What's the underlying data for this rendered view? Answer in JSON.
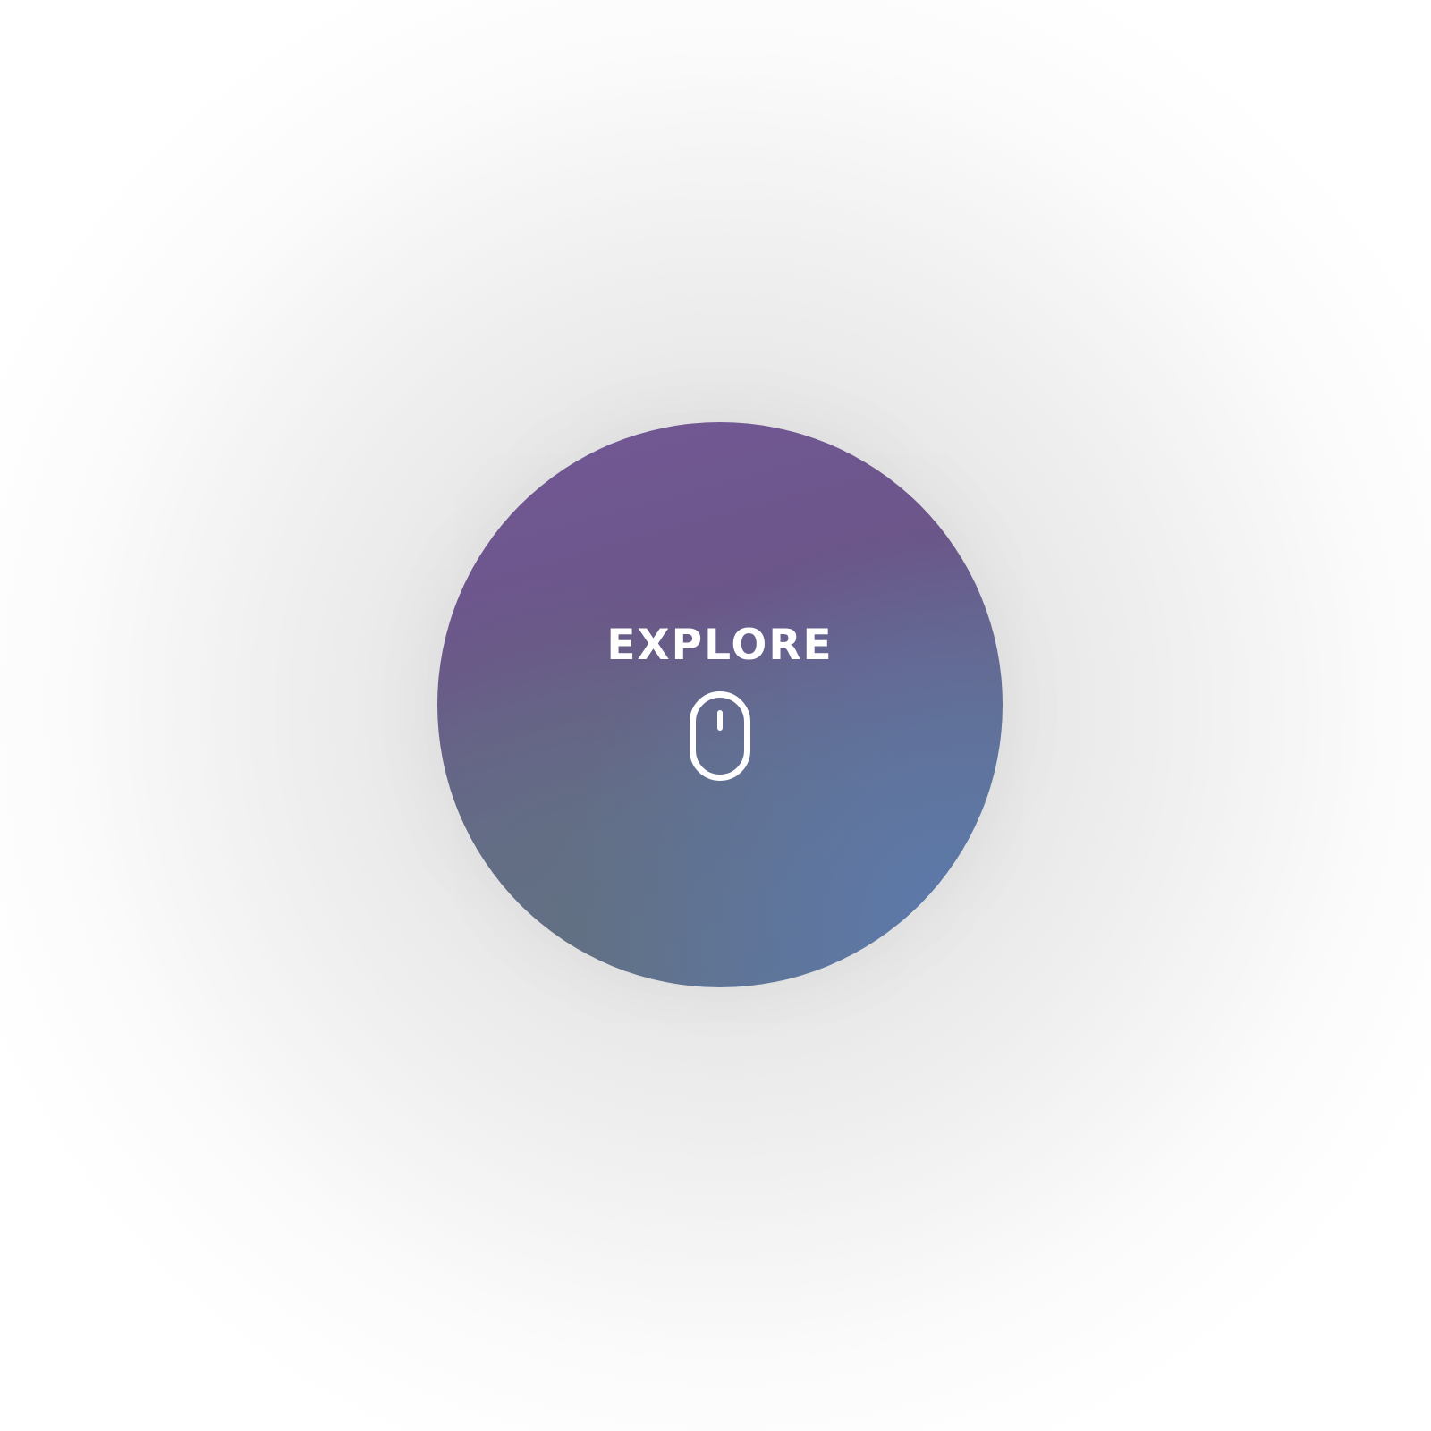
{
  "explore_button": {
    "label": "EXPLORE",
    "icon": "mouse-scroll-icon"
  },
  "colors": {
    "circle_top": "#735896",
    "circle_bottom": "#607395",
    "text": "#ffffff"
  }
}
